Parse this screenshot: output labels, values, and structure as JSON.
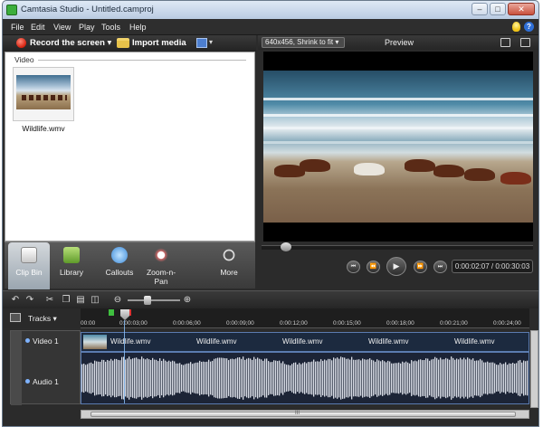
{
  "window": {
    "title": "Camtasia Studio - Untitled.camproj",
    "minimize": "–",
    "maximize": "□",
    "close": "✕"
  },
  "menu": [
    "File",
    "Edit",
    "View",
    "Play",
    "Tools",
    "Help"
  ],
  "help_glyph": "?",
  "toolbar": {
    "record_label": "Record the screen ▾",
    "import_label": "Import media",
    "produce_arrow": "▾"
  },
  "clip_bin": {
    "section": "Video",
    "clip_name": "Wildlife.wmv"
  },
  "tasks": [
    {
      "label": "Clip Bin",
      "active": true,
      "icon": "clip-bin-icon"
    },
    {
      "label": "Library",
      "active": false,
      "icon": "library-icon"
    },
    {
      "label": "Callouts",
      "active": false,
      "icon": "callouts-icon"
    },
    {
      "label": "Zoom-n-Pan",
      "active": false,
      "icon": "zoom-n-pan-icon"
    },
    {
      "label": "More",
      "active": false,
      "icon": "more-icon"
    }
  ],
  "preview": {
    "size_option": "640x456, Shrink to fit ▾",
    "label": "Preview",
    "timecode": "0:00:02:07 / 0:00:30:03"
  },
  "playback": {
    "prev": "⏮",
    "rewind": "⏪",
    "play": "▶",
    "forward": "⏩",
    "next": "⏭"
  },
  "timeline": {
    "tracks_label": "Tracks",
    "ruler_ticks": [
      "00:00",
      "0:00:03;00",
      "0:00:06;00",
      "0:00:09;00",
      "0:00:12;00",
      "0:00:15;00",
      "0:00:18;00",
      "0:00:21;00",
      "0:00:24;00"
    ],
    "video_track_name": "Video 1",
    "audio_track_name": "Audio 1",
    "clip_label": "Wildlife.wmv",
    "scroll_glyph": "III"
  },
  "colors": {
    "record": "#d4200d",
    "accent": "#5b7bb0",
    "active_tab": "#9aa6b0"
  }
}
